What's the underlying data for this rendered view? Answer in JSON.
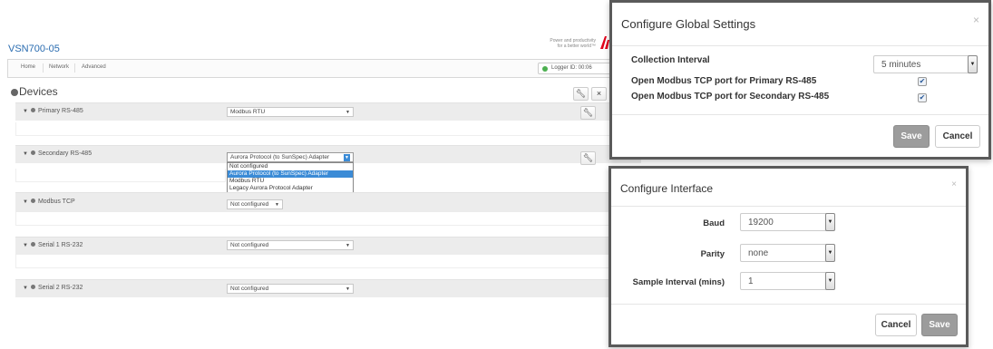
{
  "app": {
    "title": "VSN700-05",
    "tagline_line1": "Power and productivity",
    "tagline_line2": "for a better world™",
    "nav": [
      "Home",
      "Network",
      "Advanced"
    ],
    "logger_id": "Logger ID: 00:06",
    "logger_status_color": "#4caf50"
  },
  "devices": {
    "title": "Devices",
    "sections": [
      {
        "label": "Primary RS-485",
        "protocol": "Modbus RTU"
      },
      {
        "label": "Secondary RS-485",
        "protocol": "Aurora Protocol (to SunSpec) Adapter"
      },
      {
        "label": "Modbus TCP",
        "protocol": "Not configured"
      },
      {
        "label": "Serial 1 RS-232",
        "protocol": "Not configured"
      },
      {
        "label": "Serial 2 RS-232",
        "protocol": "Not configured"
      }
    ],
    "dropdown_options": [
      "Not configured",
      "Aurora Protocol (to SunSpec) Adapter",
      "Modbus RTU",
      "Legacy Aurora Protocol Adapter"
    ],
    "dropdown_selected_index": 1
  },
  "global_settings": {
    "title": "Configure Global Settings",
    "collection_interval_label": "Collection Interval",
    "collection_interval_value": "5 minutes",
    "primary_tcp_label": "Open Modbus TCP port for Primary RS-485",
    "primary_tcp_checked": true,
    "secondary_tcp_label": "Open Modbus TCP port for Secondary RS-485",
    "secondary_tcp_checked": true,
    "save_label": "Save",
    "cancel_label": "Cancel"
  },
  "interface": {
    "title": "Configure Interface",
    "baud_label": "Baud",
    "baud_value": "19200",
    "parity_label": "Parity",
    "parity_value": "none",
    "sample_label": "Sample Interval (mins)",
    "sample_value": "1",
    "cancel_label": "Cancel",
    "save_label": "Save"
  },
  "icons": {
    "close": "×",
    "check": "✔",
    "wrench": "wrench-icon",
    "remove": "×"
  }
}
